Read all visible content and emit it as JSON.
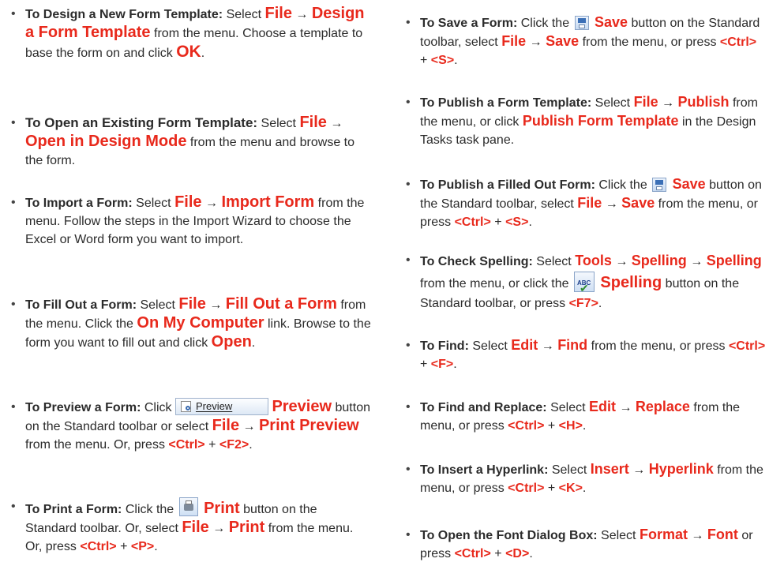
{
  "arrow": "→",
  "left": {
    "design": {
      "heading": "To Design a New Form Template:",
      "t1": "Select",
      "file": "File",
      "target": "Design a Form Template",
      "t2": "from the menu. Choose a template to base the form on and click",
      "ok": "OK",
      "t3": "."
    },
    "open": {
      "heading": "To Open an Existing Form Template:",
      "t1": "Select",
      "file": "File",
      "target": "Open in Design Mode",
      "t2": "from the menu and browse to the form."
    },
    "import": {
      "heading": "To Import a Form:",
      "t1": "Select",
      "file": "File",
      "target": "Import Form",
      "t2": "from the menu. Follow the steps in the Import Wizard to choose the Excel or Word form you want to import."
    },
    "fill": {
      "heading": "To Fill Out a Form:",
      "t1": "Select",
      "file": "File",
      "target": "Fill Out a Form",
      "t2": "from the menu. Click the",
      "link": "On My Computer",
      "t3": "link. Browse to the form you want to fill out and click",
      "open": "Open",
      "t4": "."
    },
    "preview": {
      "heading": "To Preview a Form:",
      "t1": "Click",
      "btn_label": "Preview",
      "target": "Preview",
      "t2": "button on the Standard toolbar or select",
      "file": "File",
      "cmd": "Print Preview",
      "t3": "from the menu. Or, press",
      "key1": "<Ctrl>",
      "plus": "+",
      "key2": "<F2>",
      "t4": "."
    },
    "print": {
      "heading": "To Print a Form:",
      "t1": "Click the",
      "target": "Print",
      "t2": "button on the Standard toolbar. Or, select",
      "file": "File",
      "cmd": "Print",
      "t3": "from the menu. Or, press",
      "key1": "<Ctrl>",
      "plus": "+",
      "key2": "<P>",
      "t4": "."
    }
  },
  "right": {
    "save": {
      "heading": "To Save a Form:",
      "t1": "Click the",
      "target": "Save",
      "t2": "button on the Standard toolbar, select",
      "file": "File",
      "cmd": "Save",
      "t3": "from the menu, or press",
      "key1": "<Ctrl>",
      "plus": "+",
      "key2": "<S>",
      "t4": "."
    },
    "publish_template": {
      "heading": "To Publish a Form Template:",
      "t1": "Select",
      "file": "File",
      "cmd": "Publish",
      "t2": "from the menu, or click",
      "target": "Publish Form Template",
      "t3": "in the Design Tasks task pane."
    },
    "publish_filled": {
      "heading": "To Publish a Filled Out Form:",
      "t1": "Click the",
      "target": "Save",
      "t2": "button on the Standard toolbar, select",
      "file": "File",
      "cmd": "Save",
      "t3": "from the menu, or press",
      "key1": "<Ctrl>",
      "plus": "+",
      "key2": "<S>",
      "t4": "."
    },
    "spelling": {
      "heading": "To Check Spelling:",
      "t1": "Select",
      "menu": "Tools",
      "cmd1": "Spelling",
      "cmd2": "Spelling",
      "t2": "from the menu, or click the",
      "target": "Spelling",
      "t3": "button on the Standard toolbar, or press",
      "key": "<F7>",
      "t4": "."
    },
    "find": {
      "heading": "To Find:",
      "t1": "Select",
      "menu": "Edit",
      "cmd": "Find",
      "t2": "from the menu, or press",
      "key1": "<Ctrl>",
      "plus": "+",
      "key2": "<F>",
      "t3": "."
    },
    "replace": {
      "heading": "To Find and Replace:",
      "t1": "Select",
      "menu": "Edit",
      "cmd": "Replace",
      "t2": "from the menu, or press",
      "key1": "<Ctrl>",
      "plus": "+",
      "key2": "<H>",
      "t3": "."
    },
    "hyperlink": {
      "heading": "To Insert a Hyperlink:",
      "t1": "Select",
      "menu": "Insert",
      "cmd": "Hyperlink",
      "t2": "from the menu, or press",
      "key1": "<Ctrl>",
      "plus": "+",
      "key2": "<K>",
      "t3": "."
    },
    "font": {
      "heading": "To Open the Font Dialog Box:",
      "t1": "Select",
      "menu": "Format",
      "cmd": "Font",
      "t2": "or press",
      "key1": "<Ctrl>",
      "plus": "+",
      "key2": "<D>",
      "t3": "."
    }
  }
}
